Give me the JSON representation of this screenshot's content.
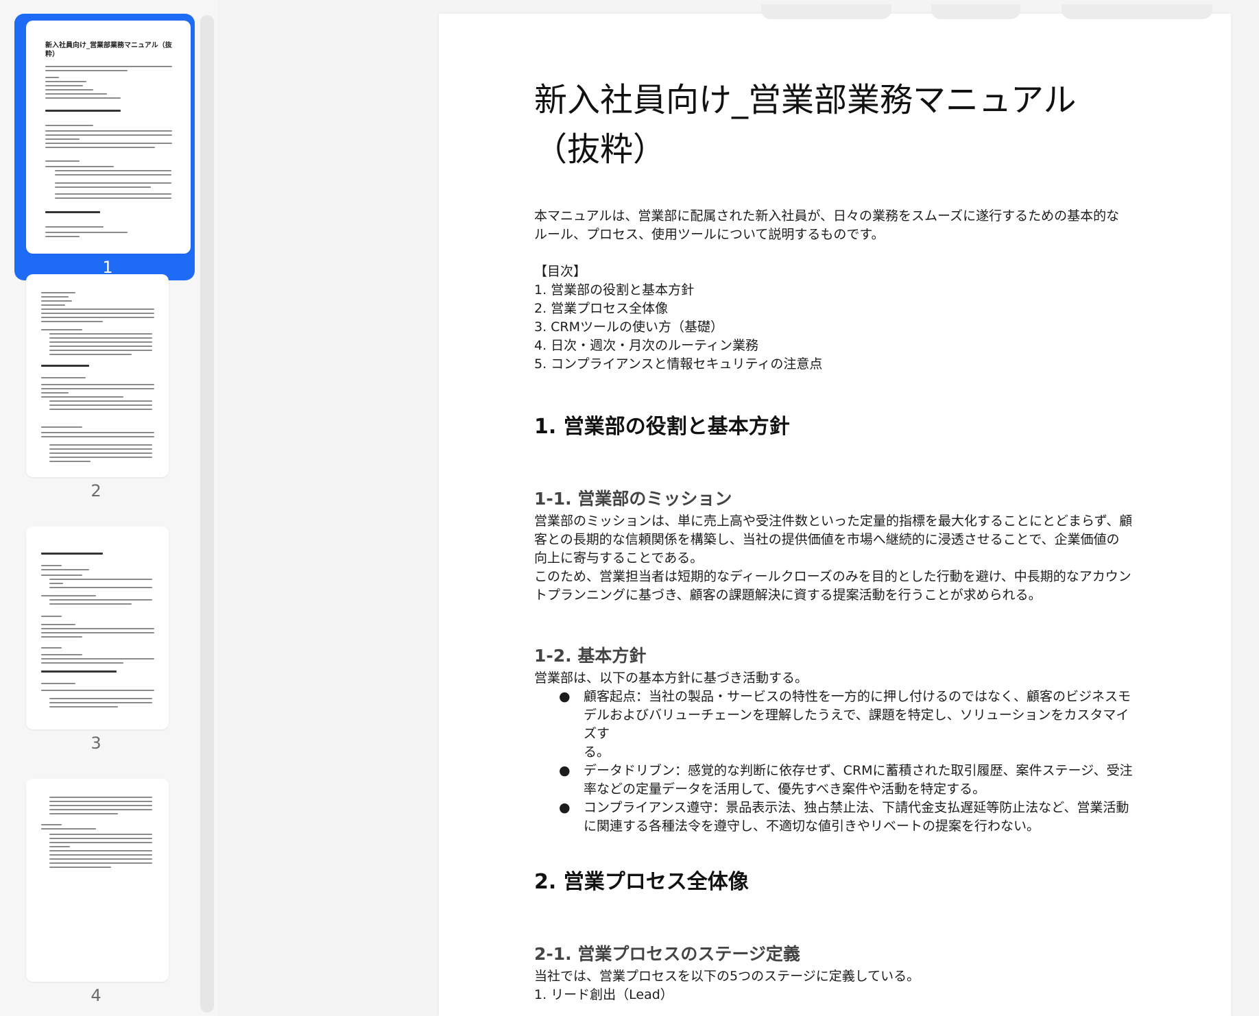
{
  "sidebar": {
    "pages": [
      {
        "number": "1",
        "selected": true,
        "thumb_title": "新入社員向け_営業部業務マニュアル（抜粋）"
      },
      {
        "number": "2",
        "selected": false
      },
      {
        "number": "3",
        "selected": false
      },
      {
        "number": "4",
        "selected": false
      }
    ]
  },
  "document": {
    "title_line1": "新入社員向け_営業部業務マニュアル",
    "title_line2": "（抜粋）",
    "intro_line1": "本マニュアルは、営業部に配属された新入社員が、日々の業務をスムーズに遂行するための基本的な",
    "intro_line2": "ルール、プロセス、使用ツールについて説明するものです。",
    "toc_header": "【目次】",
    "toc": [
      "1. 営業部の役割と基本方針",
      "2. 営業プロセス全体像",
      "3. CRMツールの使い方（基礎）",
      "4. 日次・週次・月次のルーティン業務",
      "5. コンプライアンスと情報セキュリティの注意点"
    ],
    "section1": {
      "heading": "1. 営業部の役割と基本方針",
      "sub1": {
        "heading": "1-1. 営業部のミッション",
        "lines": [
          "営業部のミッションは、単に売上高や受注件数といった定量的指標を最大化することにとどまらず、顧",
          "客との長期的な信頼関係を構築し、当社の提供価値を市場へ継続的に浸透させることで、企業価値の",
          "向上に寄与することである。",
          "このため、営業担当者は短期的なディールクローズのみを目的とした行動を避け、中長期的なアカウン",
          "トプランニングに基づき、顧客の課題解決に資する提案活動を行うことが求められる。"
        ]
      },
      "sub2": {
        "heading": "1-2. 基本方針",
        "lead": "営業部は、以下の基本方針に基づき活動する。",
        "bullets": [
          {
            "l1": "顧客起点：当社の製品・サービスの特性を一方的に押し付けるのではなく、顧客のビジネスモ",
            "l2": "デルおよびバリューチェーンを理解したうえで、課題を特定し、ソリューションをカスタマイズす",
            "l3": "る。"
          },
          {
            "l1": "データドリブン：感覚的な判断に依存せず、CRMに蓄積された取引履歴、案件ステージ、受注",
            "l2": "率などの定量データを活用して、優先すべき案件や活動を特定する。"
          },
          {
            "l1": "コンプライアンス遵守：景品表示法、独占禁止法、下請代金支払遅延等防止法など、営業活動",
            "l2": "に関連する各種法令を遵守し、不適切な値引きやリベートの提案を行わない。"
          }
        ]
      }
    },
    "section2": {
      "heading": "2. 営業プロセス全体像",
      "sub1": {
        "heading": "2-1. 営業プロセスのステージ定義",
        "lead": "当社では、営業プロセスを以下の5つのステージに定義している。",
        "item1": "1. リード創出（Lead）"
      }
    }
  }
}
